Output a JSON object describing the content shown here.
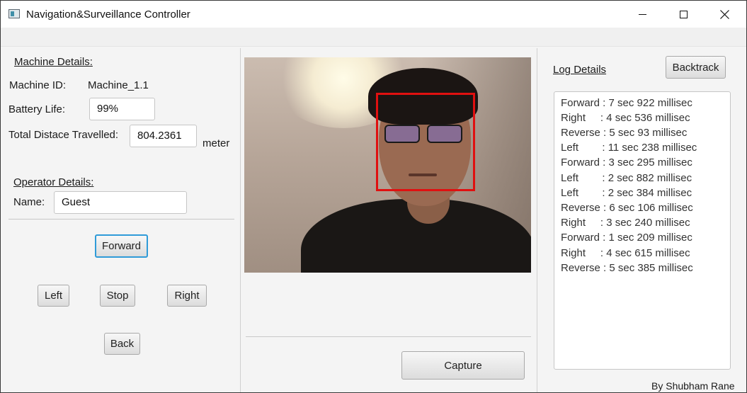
{
  "window": {
    "title": "Navigation&Surveillance Controller",
    "icons": {
      "app": "app-window-icon",
      "minimize": "minimize-icon",
      "maximize": "maximize-icon",
      "close": "close-icon"
    }
  },
  "machine": {
    "heading": "Machine Details:",
    "id_label": "Machine ID:",
    "id_value": "Machine_1.1",
    "battery_label": "Battery Life:",
    "battery_value": "99%",
    "distance_label": "Total Distace Travelled:",
    "distance_value": "804.2361",
    "distance_unit": "meter"
  },
  "operator": {
    "heading": "Operator Details:",
    "name_label": "Name:",
    "name_value": "Guest"
  },
  "controls": {
    "forward": "Forward",
    "left": "Left",
    "stop": "Stop",
    "right": "Right",
    "back": "Back"
  },
  "camera": {
    "capture_label": "Capture",
    "face_box_color": "#e01010"
  },
  "log": {
    "heading": "Log Details",
    "backtrack_label": "Backtrack",
    "entries": [
      "Forward : 7 sec 922 millisec",
      "Right     : 4 sec 536 millisec",
      "Reverse : 5 sec 93 millisec",
      "Left        : 11 sec 238 millisec",
      "Forward : 3 sec 295 millisec",
      "Left        : 2 sec 882 millisec",
      "Left        : 2 sec 384 millisec",
      "Reverse : 6 sec 106 millisec",
      "Right     : 3 sec 240 millisec",
      "Forward : 1 sec 209 millisec",
      "Right     : 4 sec 615 millisec",
      "Reverse : 5 sec 385 millisec"
    ]
  },
  "footer": {
    "credit": "By Shubham Rane"
  }
}
